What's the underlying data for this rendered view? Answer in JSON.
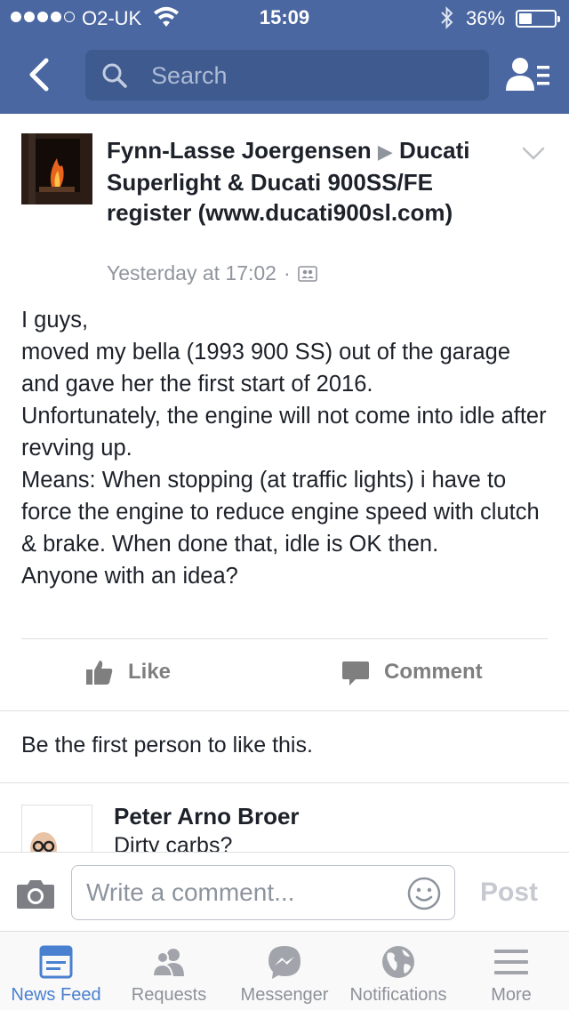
{
  "status_bar": {
    "carrier": "O2-UK",
    "time": "15:09",
    "battery_percent": "36%",
    "battery_level": 0.36,
    "signal_bars_filled": 4,
    "signal_bars_total": 5
  },
  "nav": {
    "back_icon": "chevron-left-icon",
    "search_placeholder": "Search",
    "friends_icon": "friend-list-icon"
  },
  "post": {
    "author": "Fynn-Lasse Joergensen",
    "group": "Ducati Superlight & Ducati 900SS/FE register (www.ducati900sl.com)",
    "timestamp": "Yesterday at 17:02",
    "separator": "·",
    "audience_icon": "group-audience-icon",
    "text": "I guys,\nmoved my bella (1993 900 SS) out of the garage and gave her the first start of 2016.\nUnfortunately, the engine will not come into idle after revving up.\nMeans: When stopping (at traffic lights) i have to force the engine to reduce engine speed with clutch & brake. When done that, idle is OK then.\nAnyone with an idea?"
  },
  "actions": {
    "like_label": "Like",
    "comment_label": "Comment"
  },
  "likes_summary": "Be the first person to like this.",
  "comments": [
    {
      "author": "Peter Arno Broer",
      "text": "Dirty carbs?"
    }
  ],
  "composer": {
    "placeholder": "Write a comment...",
    "post_label": "Post"
  },
  "tabs": [
    {
      "label": "News Feed",
      "icon": "news-feed-icon",
      "active": true
    },
    {
      "label": "Requests",
      "icon": "requests-icon",
      "active": false
    },
    {
      "label": "Messenger",
      "icon": "messenger-icon",
      "active": false
    },
    {
      "label": "Notifications",
      "icon": "globe-icon",
      "active": false
    },
    {
      "label": "More",
      "icon": "menu-icon",
      "active": false
    }
  ],
  "colors": {
    "brand_blue": "#4b67a1",
    "search_bg": "#3e5a8e",
    "active_tab": "#4a80d0",
    "muted_text": "#90949c"
  }
}
